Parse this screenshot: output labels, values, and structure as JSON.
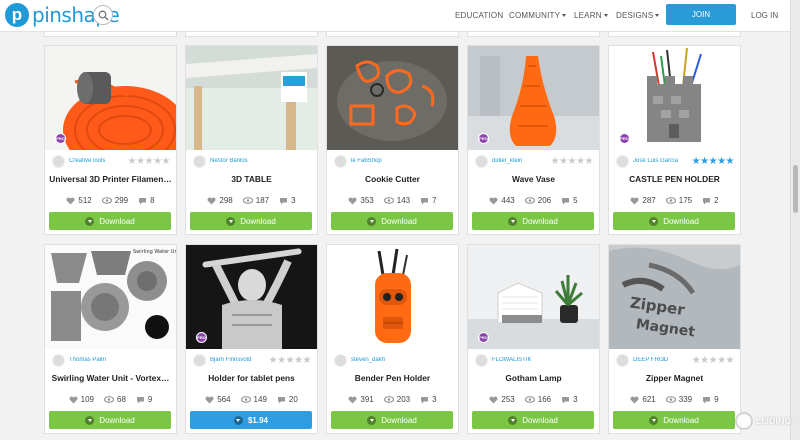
{
  "header": {
    "logo_mark": "p",
    "logo_text": "pinshape",
    "nav": [
      {
        "label": "EDUCATION",
        "dropdown": false
      },
      {
        "label": "COMMUNITY",
        "dropdown": true
      },
      {
        "label": "LEARN",
        "dropdown": true
      },
      {
        "label": "DESIGNS",
        "dropdown": true
      }
    ],
    "join_label": "JOIN",
    "login_label": "LOG IN"
  },
  "colors": {
    "brand": "#1e9ad6",
    "download": "#7cc645",
    "price": "#2f9de0",
    "star_empty": "#c9c9c9",
    "star_filled": "#2f9de0",
    "badge": "#8e44ad"
  },
  "cards": [
    {
      "title": "Universal 3D Printer Filamen…",
      "author": "CreativeTools",
      "likes": "512",
      "downloads": "299",
      "comments": "8",
      "button": "Download",
      "stars": 0,
      "badge": "PRO",
      "image": "filament-spool"
    },
    {
      "title": "3D TABLE",
      "author": "Nestor Banlos",
      "likes": "298",
      "downloads": "187",
      "comments": "3",
      "button": "Download",
      "stars": null,
      "badge": "",
      "image": "table-corner"
    },
    {
      "title": "Cookie Cutter",
      "author": "le FabShop",
      "likes": "353",
      "downloads": "143",
      "comments": "7",
      "button": "Download",
      "stars": null,
      "badge": "",
      "image": "cookie-cutters"
    },
    {
      "title": "Wave Vase",
      "author": "didier_klein",
      "likes": "443",
      "downloads": "206",
      "comments": "5",
      "button": "Download",
      "stars": 0,
      "badge": "PRO",
      "image": "orange-vase"
    },
    {
      "title": "CASTLE PEN HOLDER",
      "author": "José Luis García",
      "likes": "287",
      "downloads": "175",
      "comments": "2",
      "button": "Download",
      "stars": 5,
      "badge": "PRO",
      "image": "castle-pen-holder"
    },
    {
      "title": "Swirling Water Unit - Vortex…",
      "author": "Thomas Palm",
      "likes": "109",
      "downloads": "68",
      "comments": "9",
      "button": "Download",
      "stars": null,
      "badge": "",
      "image": "vortex-parts"
    },
    {
      "title": "Holder for tablet pens",
      "author": "Bjarn Finnsvold",
      "likes": "564",
      "downloads": "149",
      "comments": "20",
      "button": "$1.94",
      "stars": 0,
      "badge": "PRO",
      "image": "bust-holder"
    },
    {
      "title": "Bender Pen Holder",
      "author": "steven_dakh",
      "likes": "391",
      "downloads": "203",
      "comments": "3",
      "button": "Download",
      "stars": null,
      "badge": "",
      "image": "bender-head"
    },
    {
      "title": "Gotham Lamp",
      "author": "FLOWALISTIK",
      "likes": "253",
      "downloads": "166",
      "comments": "3",
      "button": "Download",
      "stars": null,
      "badge": "PRO",
      "image": "gotham-lamp"
    },
    {
      "title": "Zipper Magnet",
      "author": "DEEP FRI3D",
      "likes": "621",
      "downloads": "339",
      "comments": "9",
      "button": "Download",
      "stars": 0,
      "badge": "",
      "image": "zipper-magnet"
    }
  ],
  "watermark": "LI3DING"
}
